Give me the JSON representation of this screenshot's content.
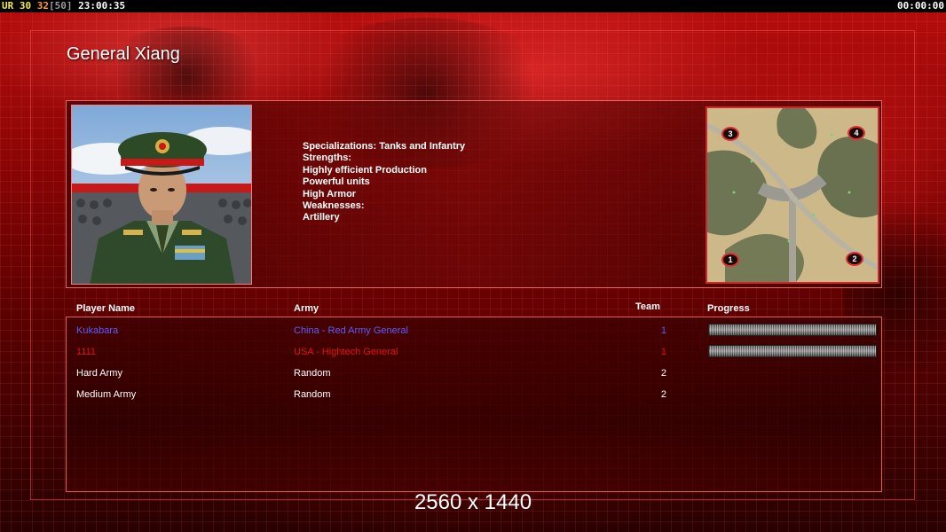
{
  "hud": {
    "fps_label": "UR",
    "fps_value": "30",
    "cur_value": "32",
    "max_value": "[50]",
    "clock": "23:00:35",
    "timer": "00:00:00"
  },
  "general": {
    "name": "General Xiang",
    "lines": [
      "Specializations: Tanks and Infantry",
      "",
      "Strengths:",
      "Highly efficient Production",
      "Powerful units",
      "High Armor",
      "",
      "Weaknesses:",
      "Artillery"
    ]
  },
  "minimap": {
    "slots": [
      "1",
      "2",
      "3",
      "4"
    ]
  },
  "table": {
    "headers": {
      "player": "Player Name",
      "army": "Army",
      "team": "Team",
      "progress": "Progress"
    },
    "rows": [
      {
        "name": "Kukabara",
        "army": "China - Red Army General",
        "team": "1",
        "color": "#5a5cff",
        "progress": 1.0
      },
      {
        "name": "1111",
        "army": "USA - Hightech General",
        "team": "1",
        "color": "#e01010",
        "progress": 1.0
      },
      {
        "name": "Hard Army",
        "army": "Random",
        "team": "2",
        "color": "#ffffff"
      },
      {
        "name": "Medium Army",
        "army": "Random",
        "team": "2",
        "color": "#ffffff"
      }
    ]
  },
  "resolution": "2560 x 1440"
}
